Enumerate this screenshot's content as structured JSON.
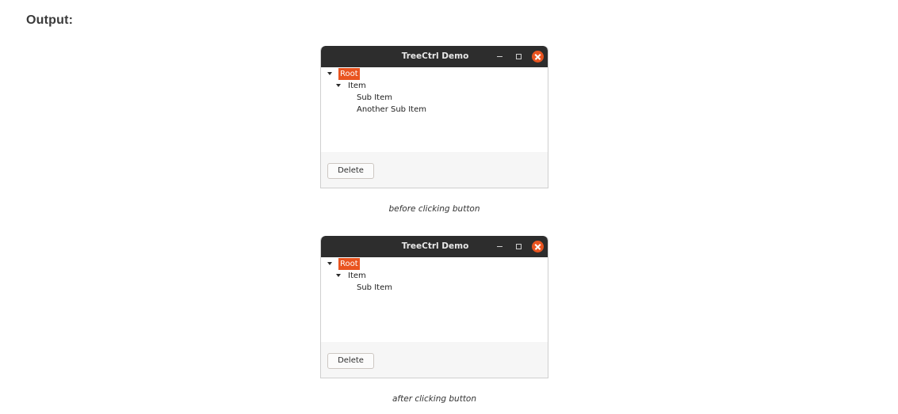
{
  "heading": "Output:",
  "windows": [
    {
      "title": "TreeCtrl Demo",
      "tree": {
        "root": "Root",
        "item": "Item",
        "children": [
          "Sub Item",
          "Another Sub Item"
        ]
      },
      "button_label": "Delete",
      "caption": "before clicking button"
    },
    {
      "title": "TreeCtrl Demo",
      "tree": {
        "root": "Root",
        "item": "Item",
        "children": [
          "Sub Item"
        ]
      },
      "button_label": "Delete",
      "caption": "after clicking button"
    }
  ],
  "colors": {
    "accent": "#e95420",
    "titlebar": "#2d2d2d"
  }
}
